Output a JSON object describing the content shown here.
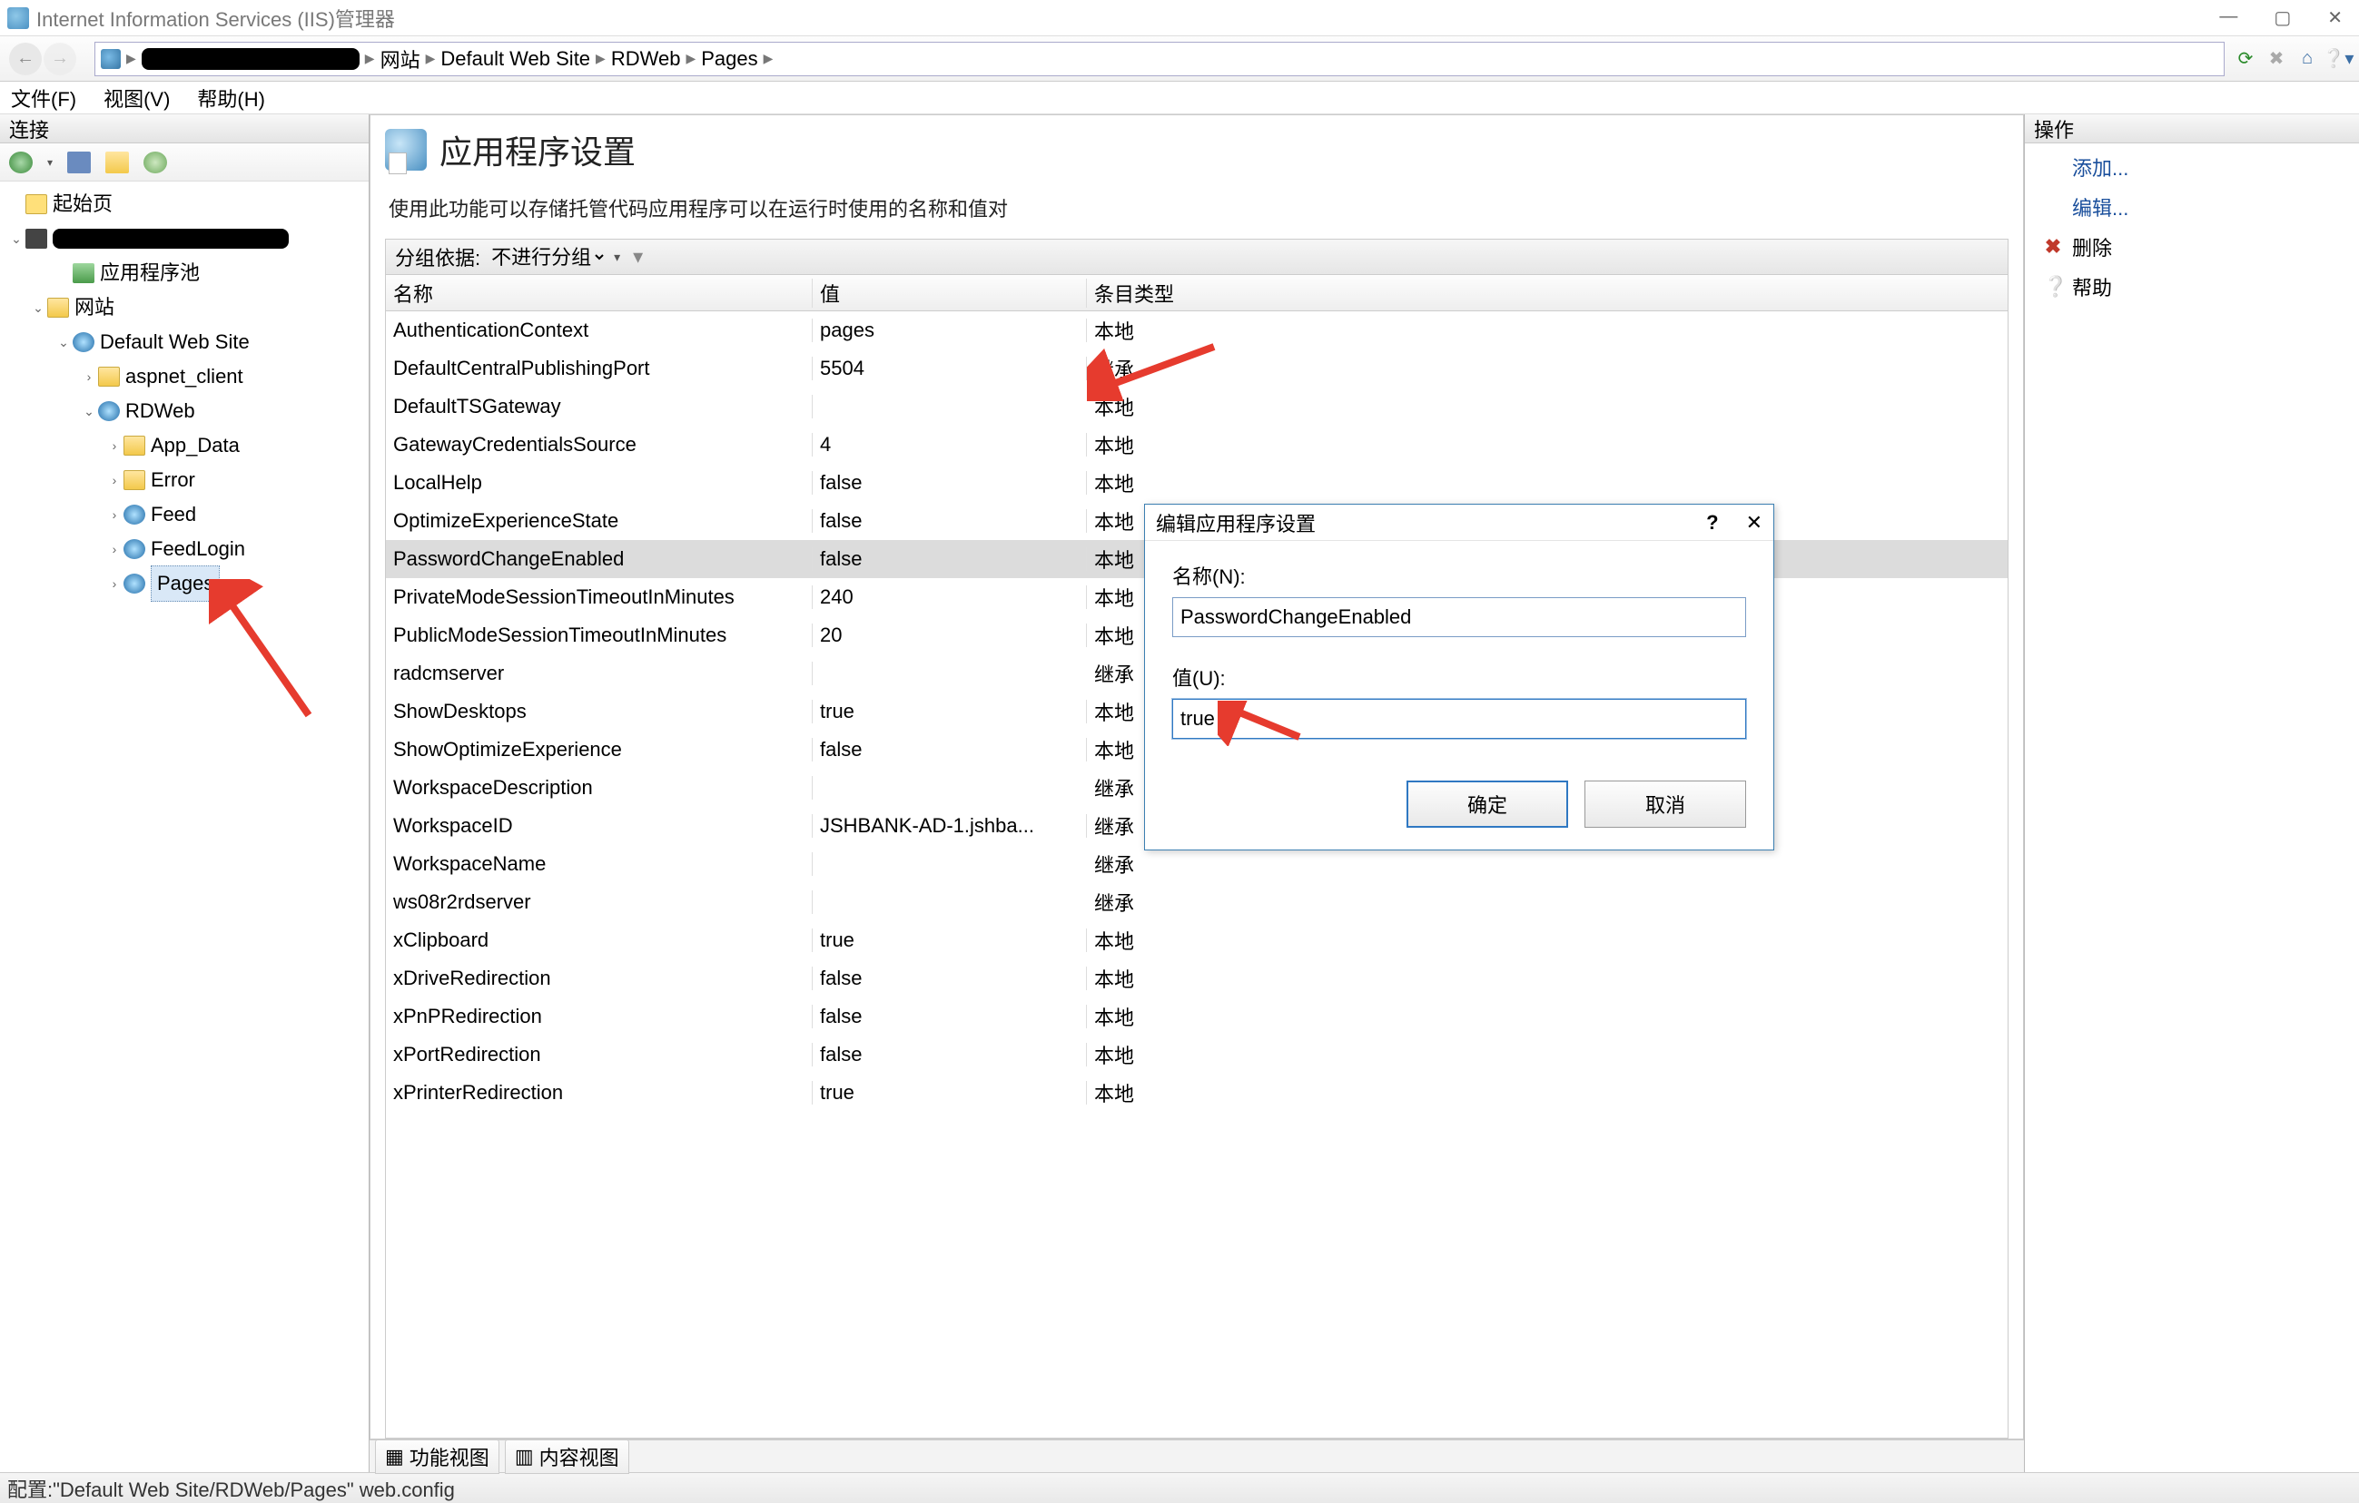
{
  "titlebar": {
    "title": "Internet Information Services (IIS)管理器"
  },
  "breadcrumb": [
    "网站",
    "Default Web Site",
    "RDWeb",
    "Pages"
  ],
  "menubar": [
    "文件(F)",
    "视图(V)",
    "帮助(H)"
  ],
  "left_panel": {
    "header": "连接"
  },
  "tree": {
    "start": "起始页",
    "pool": "应用程序池",
    "sites": "网站",
    "default_site": "Default Web Site",
    "aspnet": "aspnet_client",
    "rdweb": "RDWeb",
    "app_data": "App_Data",
    "error": "Error",
    "feed": "Feed",
    "feedlogin": "FeedLogin",
    "pages": "Pages"
  },
  "center": {
    "title": "应用程序设置",
    "desc": "使用此功能可以存储托管代码应用程序可以在运行时使用的名称和值对",
    "group_label": "分组依据:",
    "group_value": "不进行分组",
    "cols": {
      "name": "名称",
      "value": "值",
      "type": "条目类型"
    },
    "rows": [
      {
        "name": "AuthenticationContext",
        "value": "pages",
        "type": "本地"
      },
      {
        "name": "DefaultCentralPublishingPort",
        "value": "5504",
        "type": "继承"
      },
      {
        "name": "DefaultTSGateway",
        "value": "",
        "type": "本地"
      },
      {
        "name": "GatewayCredentialsSource",
        "value": "4",
        "type": "本地"
      },
      {
        "name": "LocalHelp",
        "value": "false",
        "type": "本地"
      },
      {
        "name": "OptimizeExperienceState",
        "value": "false",
        "type": "本地"
      },
      {
        "name": "PasswordChangeEnabled",
        "value": "false",
        "type": "本地",
        "selected": true
      },
      {
        "name": "PrivateModeSessionTimeoutInMinutes",
        "value": "240",
        "type": "本地"
      },
      {
        "name": "PublicModeSessionTimeoutInMinutes",
        "value": "20",
        "type": "本地"
      },
      {
        "name": "radcmserver",
        "value": "",
        "type": "继承"
      },
      {
        "name": "ShowDesktops",
        "value": "true",
        "type": "本地"
      },
      {
        "name": "ShowOptimizeExperience",
        "value": "false",
        "type": "本地"
      },
      {
        "name": "WorkspaceDescription",
        "value": "",
        "type": "继承"
      },
      {
        "name": "WorkspaceID",
        "value": "JSHBANK-AD-1.jshba...",
        "type": "继承"
      },
      {
        "name": "WorkspaceName",
        "value": "",
        "type": "继承"
      },
      {
        "name": "ws08r2rdserver",
        "value": "",
        "type": "继承"
      },
      {
        "name": "xClipboard",
        "value": "true",
        "type": "本地"
      },
      {
        "name": "xDriveRedirection",
        "value": "false",
        "type": "本地"
      },
      {
        "name": "xPnPRedirection",
        "value": "false",
        "type": "本地"
      },
      {
        "name": "xPortRedirection",
        "value": "false",
        "type": "本地"
      },
      {
        "name": "xPrinterRedirection",
        "value": "true",
        "type": "本地"
      }
    ],
    "tabs": {
      "features": "功能视图",
      "content": "内容视图"
    }
  },
  "right_panel": {
    "header": "操作",
    "actions": {
      "add": "添加...",
      "edit": "编辑...",
      "delete": "删除",
      "help": "帮助"
    }
  },
  "dialog": {
    "title": "编辑应用程序设置",
    "name_label": "名称(N):",
    "name_value": "PasswordChangeEnabled",
    "value_label": "值(U):",
    "value_value": "true",
    "ok": "确定",
    "cancel": "取消"
  },
  "statusbar": {
    "text": "配置:\"Default Web Site/RDWeb/Pages\" web.config"
  }
}
